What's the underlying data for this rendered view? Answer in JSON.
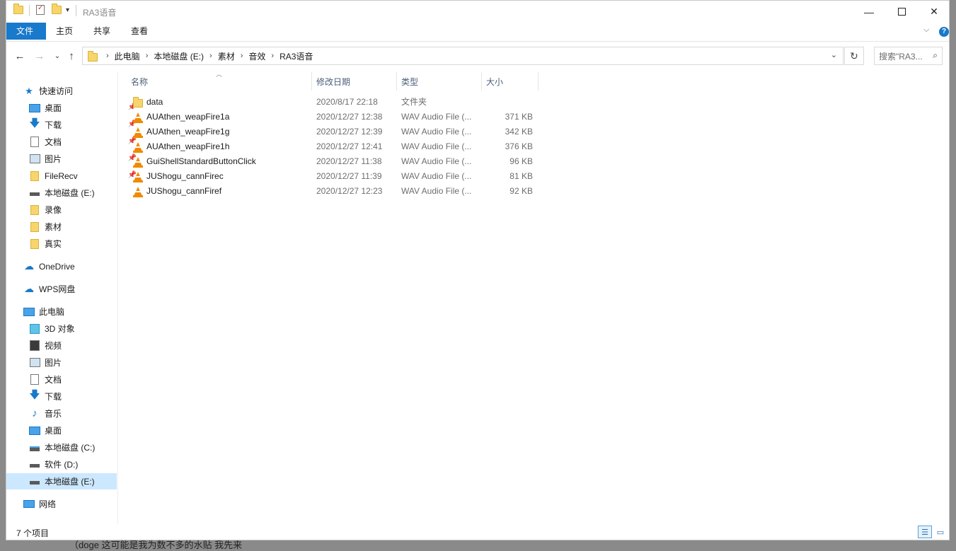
{
  "window": {
    "title": "RA3语音"
  },
  "ribbon": {
    "tabs": [
      "文件",
      "主页",
      "共享",
      "查看"
    ]
  },
  "address": {
    "crumbs": [
      "此电脑",
      "本地磁盘 (E:)",
      "素材",
      "音效",
      "RA3语音"
    ],
    "search_placeholder": "搜索\"RA3..."
  },
  "sidebar": {
    "quick_access": "快速访问",
    "quick_items": [
      {
        "label": "桌面",
        "icon": "desktop-icon",
        "pinned": true
      },
      {
        "label": "下载",
        "icon": "download-icon",
        "pinned": true
      },
      {
        "label": "文档",
        "icon": "document-icon",
        "pinned": true
      },
      {
        "label": "图片",
        "icon": "picture-icon",
        "pinned": true
      },
      {
        "label": "FileRecv",
        "icon": "folder-icon",
        "pinned": true
      },
      {
        "label": "本地磁盘 (E:)",
        "icon": "drive-icon",
        "pinned": false
      },
      {
        "label": "录像",
        "icon": "folder-icon",
        "pinned": false
      },
      {
        "label": "素材",
        "icon": "folder-icon",
        "pinned": false
      },
      {
        "label": "真实",
        "icon": "folder-icon",
        "pinned": false
      }
    ],
    "onedrive": "OneDrive",
    "wps": "WPS网盘",
    "this_pc": "此电脑",
    "pc_items": [
      {
        "label": "3D 对象",
        "icon": "3d-objects-icon"
      },
      {
        "label": "视频",
        "icon": "video-icon"
      },
      {
        "label": "图片",
        "icon": "picture-icon"
      },
      {
        "label": "文档",
        "icon": "document-icon"
      },
      {
        "label": "下载",
        "icon": "download-icon"
      },
      {
        "label": "音乐",
        "icon": "music-icon"
      },
      {
        "label": "桌面",
        "icon": "desktop-icon"
      },
      {
        "label": "本地磁盘 (C:)",
        "icon": "drive-icon"
      },
      {
        "label": "软件 (D:)",
        "icon": "drive-icon"
      },
      {
        "label": "本地磁盘 (E:)",
        "icon": "drive-icon"
      }
    ],
    "network": "网络"
  },
  "columns": [
    "名称",
    "修改日期",
    "类型",
    "大小"
  ],
  "files": [
    {
      "name": "data",
      "date": "2020/8/17 22:18",
      "type": "文件夹",
      "size": "",
      "kind": "folder"
    },
    {
      "name": "AUAthen_weapFire1a",
      "date": "2020/12/27 12:38",
      "type": "WAV Audio File (...",
      "size": "371 KB",
      "kind": "vlc"
    },
    {
      "name": "AUAthen_weapFire1g",
      "date": "2020/12/27 12:39",
      "type": "WAV Audio File (...",
      "size": "342 KB",
      "kind": "vlc"
    },
    {
      "name": "AUAthen_weapFire1h",
      "date": "2020/12/27 12:41",
      "type": "WAV Audio File (...",
      "size": "376 KB",
      "kind": "vlc"
    },
    {
      "name": "GuiShellStandardButtonClick",
      "date": "2020/12/27 11:38",
      "type": "WAV Audio File (...",
      "size": "96 KB",
      "kind": "vlc"
    },
    {
      "name": "JUShogu_cannFirec",
      "date": "2020/12/27 11:39",
      "type": "WAV Audio File (...",
      "size": "81 KB",
      "kind": "vlc"
    },
    {
      "name": "JUShogu_cannFiref",
      "date": "2020/12/27 12:23",
      "type": "WAV Audio File (...",
      "size": "92 KB",
      "kind": "vlc"
    }
  ],
  "status": {
    "count": "7 个项目"
  },
  "caption": "（doge 这可能是我为数不多的水贴 我先来"
}
